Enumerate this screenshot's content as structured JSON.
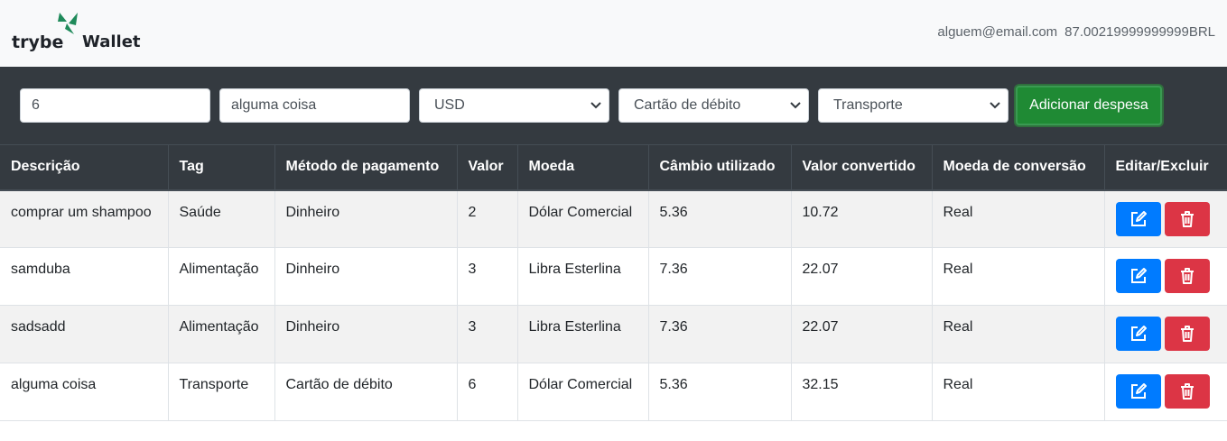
{
  "header": {
    "logo_text_1": "trybe",
    "logo_text_2": "Wallet",
    "email": "alguem@email.com",
    "total": "87.00219999999999BRL"
  },
  "form": {
    "value": "6",
    "description": "alguma coisa",
    "currency": "USD",
    "method": "Cartão de débito",
    "tag": "Transporte",
    "add_button": "Adicionar despesa"
  },
  "table": {
    "headers": [
      "Descrição",
      "Tag",
      "Método de pagamento",
      "Valor",
      "Moeda",
      "Câmbio utilizado",
      "Valor convertido",
      "Moeda de conversão",
      "Editar/Excluir"
    ],
    "rows": [
      [
        "comprar um shampoo",
        "Saúde",
        "Dinheiro",
        "2",
        "Dólar Comercial",
        "5.36",
        "10.72",
        "Real"
      ],
      [
        "samduba",
        "Alimentação",
        "Dinheiro",
        "3",
        "Libra Esterlina",
        "7.36",
        "22.07",
        "Real"
      ],
      [
        "sadsadd",
        "Alimentação",
        "Dinheiro",
        "3",
        "Libra Esterlina",
        "7.36",
        "22.07",
        "Real"
      ],
      [
        "alguma coisa",
        "Transporte",
        "Cartão de débito",
        "6",
        "Dólar Comercial",
        "5.36",
        "32.15",
        "Real"
      ]
    ]
  },
  "icons": {
    "edit": "edit-icon",
    "delete": "trash-icon"
  },
  "colors": {
    "edit": "#007bff",
    "delete": "#dc3545",
    "add": "#1f8a34",
    "dark": "#343a40"
  }
}
